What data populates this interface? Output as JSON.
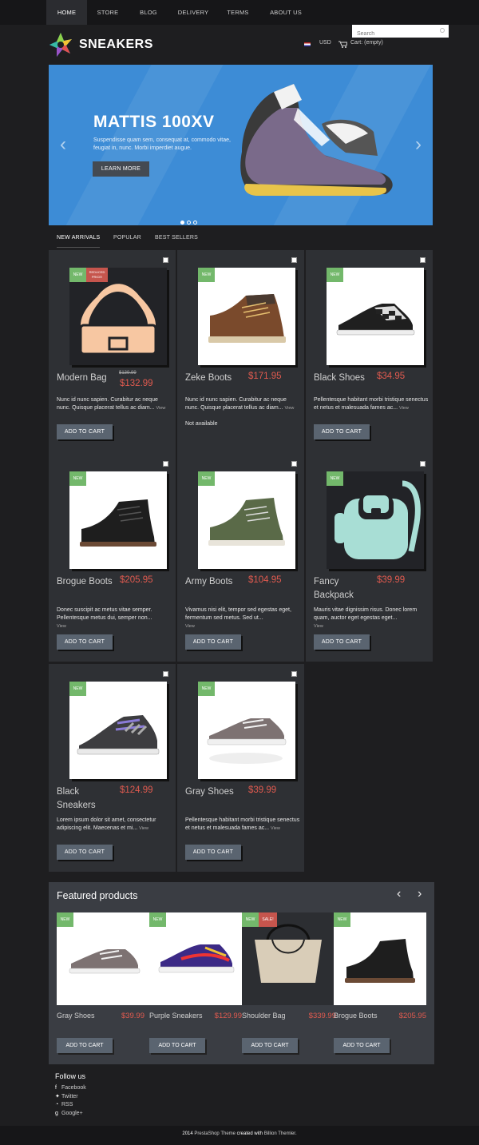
{
  "nav": [
    "HOME",
    "STORE",
    "BLOG",
    "DELIVERY",
    "TERMS",
    "ABOUT US"
  ],
  "search": {
    "placeholder": "Search"
  },
  "logo": {
    "name": "SNEAKERS"
  },
  "header": {
    "currency": "USD",
    "cart": "Cart: (empty)"
  },
  "banner": {
    "title": "MATTIS 100XV",
    "text": "Suspendisse quam sem, consequat at, commodo vitae, feugiat in, nunc. Morbi imperdiet augue.",
    "button": "LEARN MORE"
  },
  "tabs": [
    "NEW ARRIVALS",
    "POPULAR",
    "BEST SELLERS"
  ],
  "labels": {
    "new": "NEW",
    "reduced": "REDUCED PRICE!",
    "sale": "SALE!",
    "add_to_cart": "ADD TO CART",
    "view": "View",
    "not_available": "Not available"
  },
  "products": [
    {
      "name": "Modern Bag",
      "old_price": "$139.99",
      "price": "$132.99",
      "desc": "Nunc id nunc sapien. Curabitur ac neque nunc. Quisque placerat tellus ac diam..."
    },
    {
      "name": "Zeke Boots",
      "price": "$171.95",
      "desc": "Nunc id nunc sapien. Curabitur ac neque nunc. Quisque placerat tellus ac diam..."
    },
    {
      "name": "Black Shoes",
      "price": "$34.95",
      "desc": "Pellentesque habitant morbi tristique senectus et netus et malesuada fames ac..."
    },
    {
      "name": "Brogue Boots",
      "price": "$205.95",
      "desc": "Donec suscipit ac metus vitae semper. Pellentesque metus dui, semper non..."
    },
    {
      "name": "Army Boots",
      "price": "$104.95",
      "desc": "Vivamus nisi elit, tempor sed egestas eget, fermentum sed metus. Sed ut..."
    },
    {
      "name": "Fancy Backpack",
      "price": "$39.99",
      "desc": "Mauris vitae dignissim risus. Donec lorem quam, auctor eget egestas eget..."
    },
    {
      "name": "Black Sneakers",
      "price": "$124.99",
      "desc": "Lorem ipsum dolor sit amet, consectetur adipiscing elit. Maecenas et mi..."
    },
    {
      "name": "Gray Shoes",
      "price": "$39.99",
      "desc": "Pellentesque habitant morbi tristique senectus et netus et malesuada fames ac..."
    }
  ],
  "featured": {
    "title": "Featured products",
    "items": [
      {
        "name": "Gray Shoes",
        "price": "$39.99"
      },
      {
        "name": "Purple Sneakers",
        "price": "$129.99"
      },
      {
        "name": "Shoulder Bag",
        "price": "$339.99"
      },
      {
        "name": "Brogue Boots",
        "price": "$205.95"
      }
    ]
  },
  "follow": {
    "title": "Follow us",
    "links": [
      "Facebook",
      "Twitter",
      "RSS",
      "Google+"
    ]
  },
  "footer": {
    "year": "2014",
    "theme": "PrestaShop Theme",
    "mid": "created with",
    "author": "Billion Themler"
  }
}
